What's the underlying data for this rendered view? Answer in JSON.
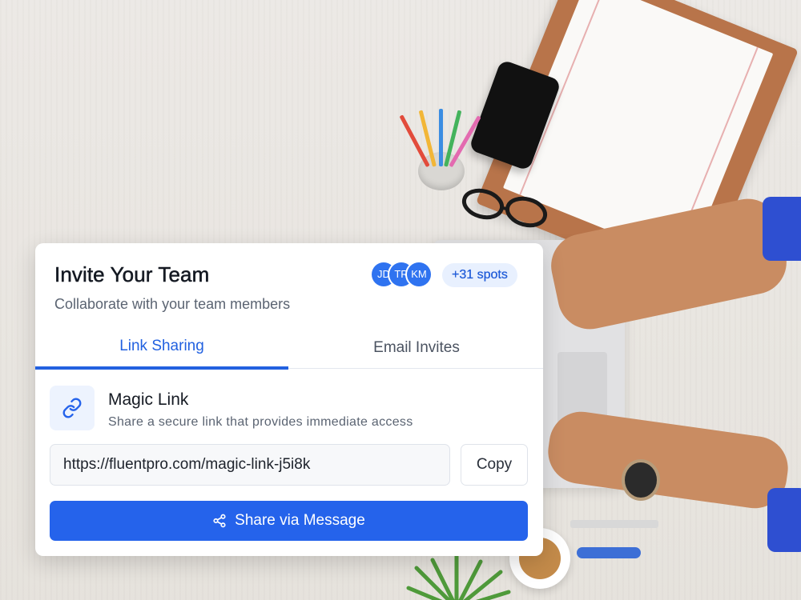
{
  "card": {
    "title": "Invite Your Team",
    "subtitle": "Collaborate with your team members",
    "avatars": [
      "JD",
      "TR",
      "KM"
    ],
    "spots_badge": "+31 spots"
  },
  "tabs": [
    {
      "label": "Link Sharing",
      "active": true
    },
    {
      "label": "Email Invites",
      "active": false
    }
  ],
  "magic_link": {
    "icon": "link-icon",
    "title": "Magic Link",
    "description": "Share a secure link that provides immediate access",
    "url": "https://fluentpro.com/magic-link-j5i8k",
    "copy_label": "Copy",
    "share_label": "Share via Message",
    "share_icon": "share-icon"
  },
  "colors": {
    "accent": "#2563eb",
    "tab_active": "#2261e0",
    "badge_bg": "#e8f0fe",
    "avatar_bg": "#2f73f0"
  }
}
